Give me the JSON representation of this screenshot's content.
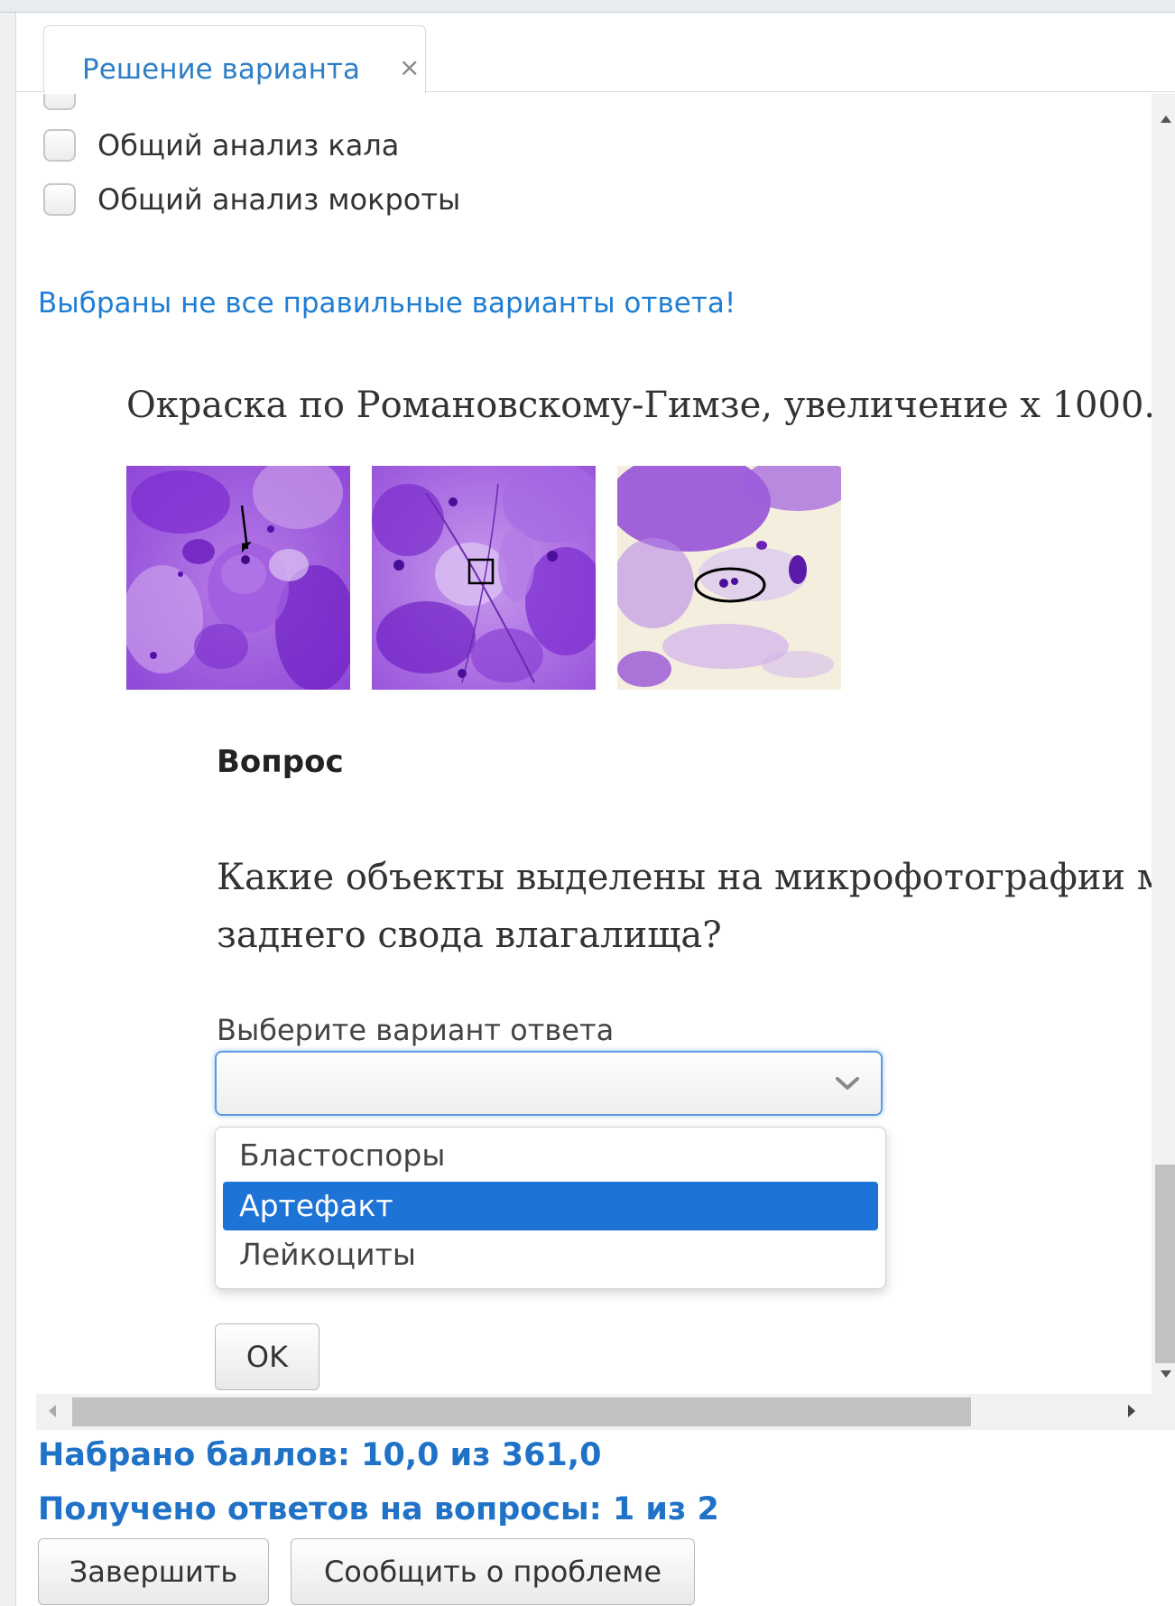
{
  "tab": {
    "title": "Решение варианта",
    "close_glyph": "×"
  },
  "options_list": [
    {
      "label": "Общий анализ кала",
      "checked": false
    },
    {
      "label": "Общий анализ мокроты",
      "checked": false
    }
  ],
  "warning": "Выбраны не все правильные варианты ответа!",
  "question": {
    "caption": "Окраска по Романовскому-Гимзе, увеличение х 1000.",
    "heading": "Вопрос",
    "text_line1": "Какие объекты выделены на микрофотографии мазка",
    "text_line2": "заднего свода влагалища?",
    "select_label": "Выберите вариант ответа",
    "select_value": "",
    "dropdown_options": [
      "Бластоспоры",
      "Артефакт",
      "Лейкоциты"
    ],
    "highlighted_option": "Артефакт",
    "ok_label": "OK"
  },
  "score": {
    "points": "Набрано баллов: 10,0 из 361,0",
    "answers": "Получено ответов на вопросы: 1 из 2"
  },
  "footer": {
    "finish_label": "Завершить",
    "report_label": "Сообщить о проблеме"
  },
  "colors": {
    "link_blue": "#1f7ed4",
    "selected_option": "#1e73d6",
    "stain_purple": "#8a3fd6"
  }
}
